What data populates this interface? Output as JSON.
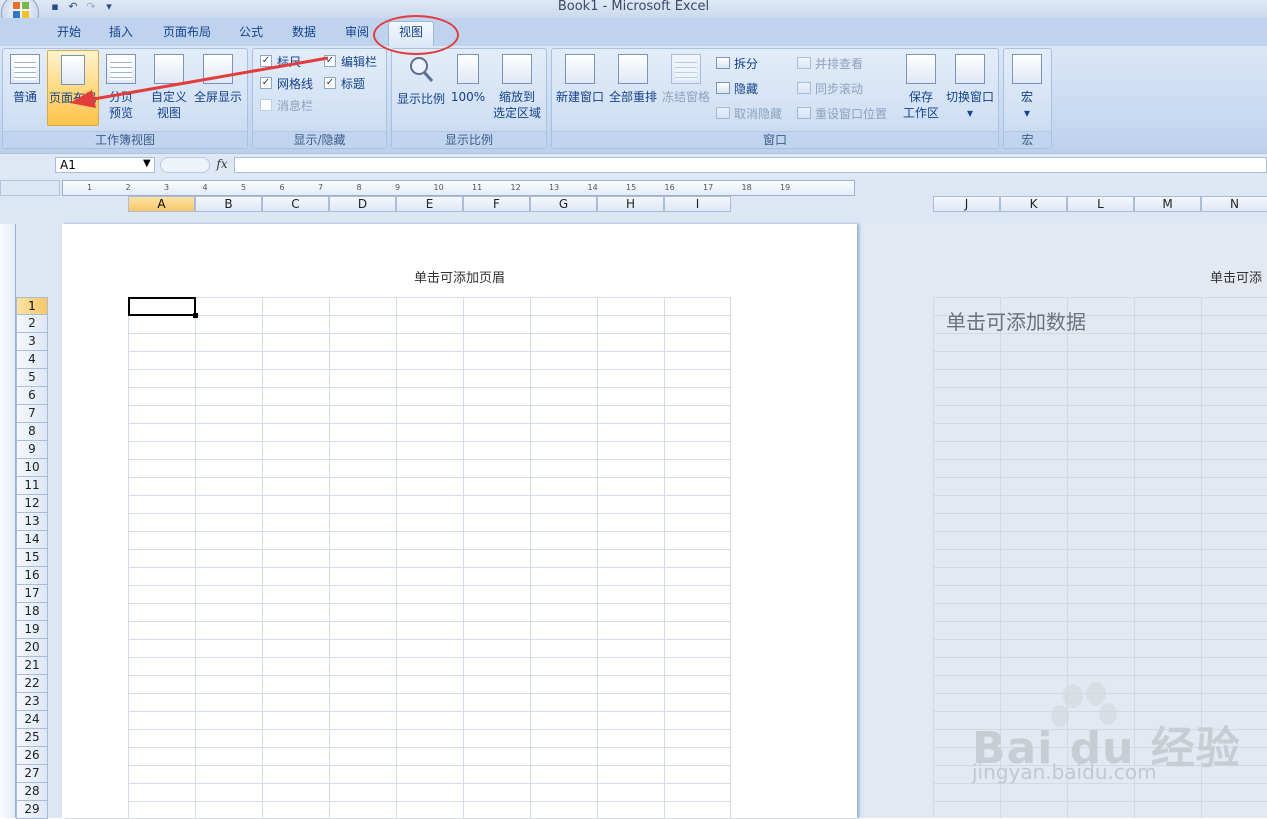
{
  "window": {
    "title": "Book1 - Microsoft Excel"
  },
  "tabs": [
    "开始",
    "插入",
    "页面布局",
    "公式",
    "数据",
    "审阅",
    "视图"
  ],
  "active_tab": "视图",
  "ribbon": {
    "workbook_views": {
      "label": "工作簿视图",
      "normal": "普通",
      "page_layout": "页面布局",
      "page_break_1": "分页",
      "page_break_2": "预览",
      "custom_1": "自定义",
      "custom_2": "视图",
      "fullscreen": "全屏显示"
    },
    "show_hide": {
      "label": "显示/隐藏",
      "ruler": "标尺",
      "formula_bar": "编辑栏",
      "gridlines": "网格线",
      "headings": "标题",
      "message_bar": "消息栏"
    },
    "zoom": {
      "label": "显示比例",
      "zoom": "显示比例",
      "hundred": "100%",
      "zoom_sel_1": "缩放到",
      "zoom_sel_2": "选定区域"
    },
    "window": {
      "label": "窗口",
      "new_window": "新建窗口",
      "arrange_all": "全部重排",
      "freeze": "冻结窗格",
      "split": "拆分",
      "hide": "隐藏",
      "unhide": "取消隐藏",
      "side_by_side": "并排查看",
      "sync_scroll": "同步滚动",
      "reset_pos": "重设窗口位置",
      "save_ws_1": "保存",
      "save_ws_2": "工作区",
      "switch": "切换窗口"
    },
    "macros": {
      "label": "宏",
      "macros": "宏"
    }
  },
  "formula_bar": {
    "name_box": "A1",
    "fx": "fx",
    "value": ""
  },
  "columns": [
    "A",
    "B",
    "C",
    "D",
    "E",
    "F",
    "G",
    "H",
    "I"
  ],
  "columns_page2": [
    "J",
    "K",
    "L",
    "M",
    "N"
  ],
  "rows": [
    "1",
    "2",
    "3",
    "4",
    "5",
    "6",
    "7",
    "8",
    "9",
    "10",
    "11",
    "12",
    "13",
    "14",
    "15",
    "16",
    "17",
    "18",
    "19",
    "20",
    "21",
    "22",
    "23",
    "24",
    "25",
    "26",
    "27",
    "28",
    "29"
  ],
  "ruler_marks": [
    "1",
    "2",
    "3",
    "4",
    "5",
    "6",
    "7",
    "8",
    "9",
    "10",
    "11",
    "12",
    "13",
    "14",
    "15",
    "16",
    "17",
    "18",
    "19"
  ],
  "page": {
    "header_placeholder": "单击可添加页眉",
    "header_placeholder_partial": "单击可添",
    "data_placeholder": "单击可添加数据"
  },
  "watermark": {
    "brand": "Bai du 经验",
    "url": "jingyan.baidu.com"
  },
  "colors": {
    "annotation_red": "#e23c3c",
    "selection_orange": "#f7c767"
  }
}
